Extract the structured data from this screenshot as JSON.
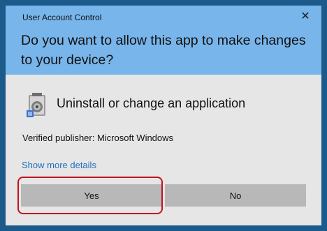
{
  "window": {
    "title": "User Account Control",
    "close_glyph": "✕"
  },
  "prompt": {
    "question": "Do you want to allow this app to make changes to your device?"
  },
  "app": {
    "icon": "installer-icon",
    "name": "Uninstall or change an application",
    "publisher": "Verified publisher: Microsoft Windows"
  },
  "details_link": "Show more details",
  "buttons": {
    "yes": "Yes",
    "no": "No"
  },
  "colors": {
    "header": "#78b5ea",
    "body": "#e6e6e6",
    "link": "#1f6fbf",
    "highlight": "#c3121f"
  }
}
